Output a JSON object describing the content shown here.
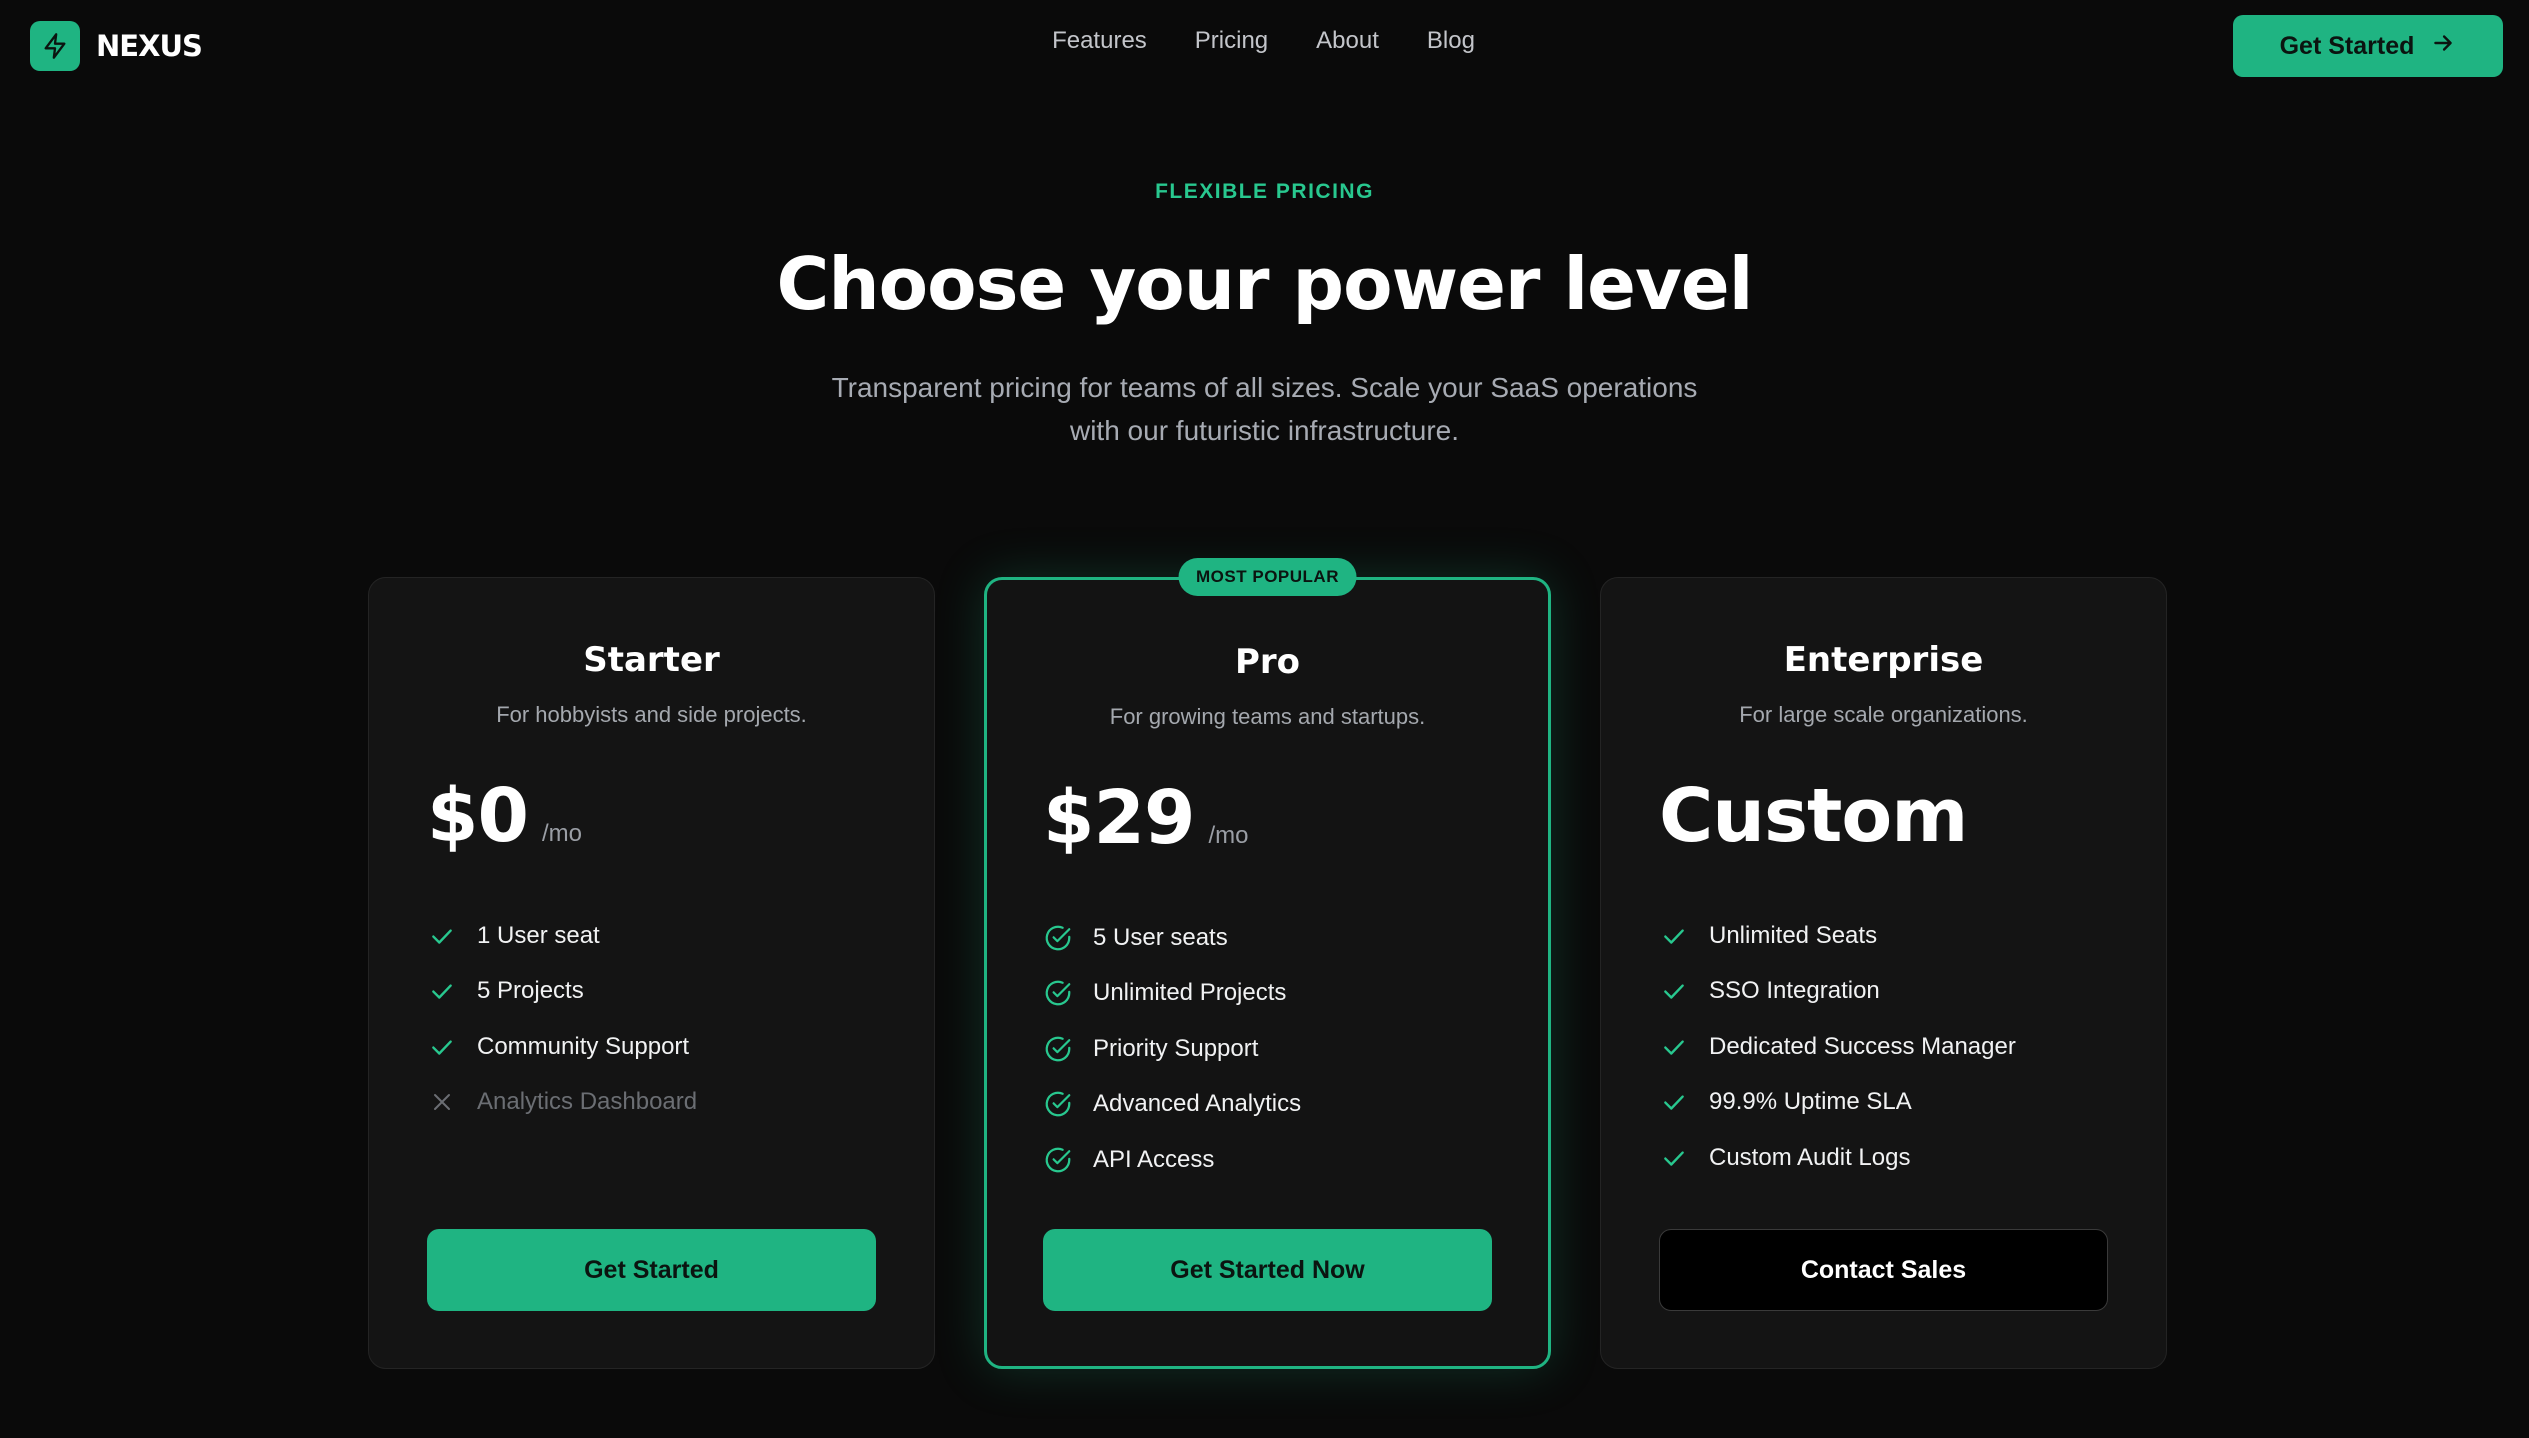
{
  "nav": {
    "brand": "NEXUS",
    "links": [
      "Features",
      "Pricing",
      "About",
      "Blog"
    ],
    "cta_label": "Get Started"
  },
  "hero": {
    "eyebrow": "FLEXIBLE PRICING",
    "headline": "Choose your power level",
    "subhead": "Transparent pricing for teams of all sizes. Scale your SaaS operations with our futuristic infrastructure."
  },
  "plans": [
    {
      "name": "Starter",
      "description": "For hobbyists and side projects.",
      "price": "$0",
      "period": "/mo",
      "features": [
        {
          "text": "1 User seat",
          "included": true
        },
        {
          "text": "5 Projects",
          "included": true
        },
        {
          "text": "Community Support",
          "included": true
        },
        {
          "text": "Analytics Dashboard",
          "included": false
        }
      ],
      "cta": "Get Started"
    },
    {
      "name": "Pro",
      "badge": "MOST POPULAR",
      "description": "For growing teams and startups.",
      "price": "$29",
      "period": "/mo",
      "features": [
        {
          "text": "5 User seats",
          "included": true
        },
        {
          "text": "Unlimited Projects",
          "included": true
        },
        {
          "text": "Priority Support",
          "included": true
        },
        {
          "text": "Advanced Analytics",
          "included": true
        },
        {
          "text": "API Access",
          "included": true
        }
      ],
      "cta": "Get Started Now"
    },
    {
      "name": "Enterprise",
      "description": "For large scale organizations.",
      "price": "Custom",
      "features": [
        {
          "text": "Unlimited Seats",
          "included": true
        },
        {
          "text": "SSO Integration",
          "included": true
        },
        {
          "text": "Dedicated Success Manager",
          "included": true
        },
        {
          "text": "99.9% Uptime SLA",
          "included": true
        },
        {
          "text": "Custom Audit Logs",
          "included": true
        }
      ],
      "cta": "Contact Sales"
    }
  ],
  "colors": {
    "accent": "#1fb482",
    "background": "#0a0a0a",
    "card": "#141414"
  },
  "icons": {
    "logo": "lightning-bolt-icon",
    "cta_arrow": "arrow-right-icon",
    "check": "check-icon",
    "check_circle": "check-circle-icon",
    "cross": "x-icon"
  }
}
